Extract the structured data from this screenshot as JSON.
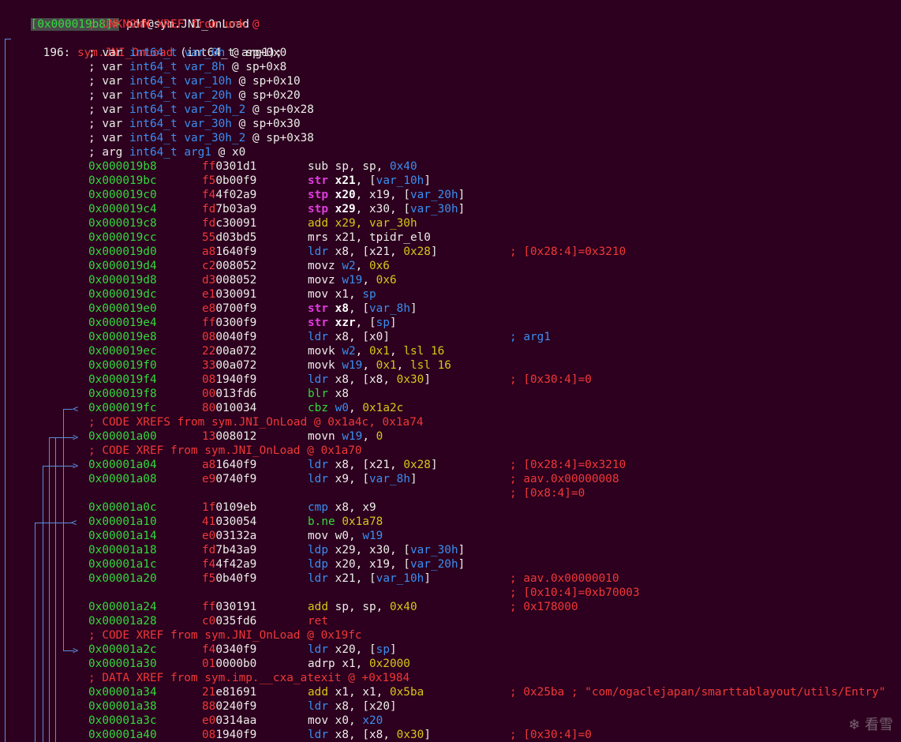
{
  "prompt": {
    "addr": "[0x000019b8]>",
    "cmd": " pdf@sym.JNI_OnLoad"
  },
  "header": {
    "xref": "; UNKNOWN XREF from unk @",
    "func_num": "196:",
    "func_name": "sym.JNI_OnLoad",
    "func_sig": " (int64_t arg1);"
  },
  "vars": [
    {
      "t": "; var ",
      "type": "int64_t",
      "name": "var_0h",
      "loc": " @ sp+0x0"
    },
    {
      "t": "; var ",
      "type": "int64_t",
      "name": "var_8h",
      "loc": " @ sp+0x8"
    },
    {
      "t": "; var ",
      "type": "int64_t",
      "name": "var_10h",
      "loc": " @ sp+0x10"
    },
    {
      "t": "; var ",
      "type": "int64_t",
      "name": "var_20h",
      "loc": " @ sp+0x20"
    },
    {
      "t": "; var ",
      "type": "int64_t",
      "name": "var_20h_2",
      "loc": " @ sp+0x28"
    },
    {
      "t": "; var ",
      "type": "int64_t",
      "name": "var_30h",
      "loc": " @ sp+0x30"
    },
    {
      "t": "; var ",
      "type": "int64_t",
      "name": "var_30h_2",
      "loc": " @ sp+0x38"
    },
    {
      "t": "; arg ",
      "type": "int64_t",
      "name": "arg1",
      "loc": " @ x0"
    }
  ],
  "xrefs": {
    "x1": "; CODE XREFS from sym.JNI_OnLoad @ 0x1a4c, 0x1a74",
    "x2": "; CODE XREF from sym.JNI_OnLoad @ 0x1a70",
    "x3": "; CODE XREF from sym.JNI_OnLoad @ 0x19fc",
    "x4": "; DATA XREF from sym.imp.__cxa_atexit @ +0x1984"
  },
  "insns": [
    {
      "a": "0x000019b8",
      "b1": "ff",
      "b2": "0301d1",
      "m": "sub",
      "mc": "white",
      "ops": [
        [
          "sp, sp, ",
          "white"
        ],
        [
          "0x40",
          "blue"
        ]
      ],
      "c": ""
    },
    {
      "a": "0x000019bc",
      "b1": "f5",
      "b2": "0b00f9",
      "m": "str",
      "mc": "mag",
      "ops": [
        [
          "x21",
          "wb"
        ],
        [
          ", [",
          "white"
        ],
        [
          "var_10h",
          "blue"
        ],
        [
          "]",
          "white"
        ]
      ],
      "c": ""
    },
    {
      "a": "0x000019c0",
      "b1": "f4",
      "b2": "4f02a9",
      "m": "stp",
      "mc": "mag",
      "ops": [
        [
          "x20",
          "wb"
        ],
        [
          ", x19, [",
          "white"
        ],
        [
          "var_20h",
          "blue"
        ],
        [
          "]",
          "white"
        ]
      ],
      "c": ""
    },
    {
      "a": "0x000019c4",
      "b1": "fd",
      "b2": "7b03a9",
      "m": "stp",
      "mc": "mag",
      "ops": [
        [
          "x29",
          "wb"
        ],
        [
          ", x30, [",
          "white"
        ],
        [
          "var_30h",
          "blue"
        ],
        [
          "]",
          "white"
        ]
      ],
      "c": ""
    },
    {
      "a": "0x000019c8",
      "b1": "fd",
      "b2": "c30091",
      "m": "add",
      "mc": "yellow",
      "ops": [
        [
          "x29, var_30h",
          "yellow"
        ]
      ],
      "c": ""
    },
    {
      "a": "0x000019cc",
      "b1": "55",
      "b2": "d03bd5",
      "m": "mrs",
      "mc": "white",
      "ops": [
        [
          "x21, tpidr_el0",
          "white"
        ]
      ],
      "c": ""
    },
    {
      "a": "0x000019d0",
      "b1": "a8",
      "b2": "1640f9",
      "m": "ldr",
      "mc": "blue",
      "ops": [
        [
          "x8, [x21, ",
          "white"
        ],
        [
          "0x28",
          "yellow"
        ],
        [
          "]",
          "white"
        ]
      ],
      "c": "; [0x28:4]=0x3210",
      "cc": "red"
    },
    {
      "a": "0x000019d4",
      "b1": "c2",
      "b2": "008052",
      "m": "movz",
      "mc": "white",
      "ops": [
        [
          "w2",
          "blue"
        ],
        [
          ", ",
          "white"
        ],
        [
          "0x6",
          "yellow"
        ]
      ],
      "c": ""
    },
    {
      "a": "0x000019d8",
      "b1": "d3",
      "b2": "008052",
      "m": "movz",
      "mc": "white",
      "ops": [
        [
          "w19",
          "blue"
        ],
        [
          ", ",
          "white"
        ],
        [
          "0x6",
          "yellow"
        ]
      ],
      "c": ""
    },
    {
      "a": "0x000019dc",
      "b1": "e1",
      "b2": "030091",
      "m": "mov",
      "mc": "white",
      "ops": [
        [
          "x1, ",
          "white"
        ],
        [
          "sp",
          "blue"
        ]
      ],
      "c": ""
    },
    {
      "a": "0x000019e0",
      "b1": "e8",
      "b2": "0700f9",
      "m": "str",
      "mc": "mag",
      "ops": [
        [
          "x8",
          "wb"
        ],
        [
          ", [",
          "white"
        ],
        [
          "var_8h",
          "blue"
        ],
        [
          "]",
          "white"
        ]
      ],
      "c": ""
    },
    {
      "a": "0x000019e4",
      "b1": "ff",
      "b2": "0300f9",
      "m": "str",
      "mc": "mag",
      "ops": [
        [
          "xzr",
          "wb"
        ],
        [
          ", [",
          "white"
        ],
        [
          "sp",
          "blue"
        ],
        [
          "]",
          "white"
        ]
      ],
      "c": ""
    },
    {
      "a": "0x000019e8",
      "b1": "08",
      "b2": "0040f9",
      "m": "ldr",
      "mc": "blue",
      "ops": [
        [
          "x8, [x0]",
          "white"
        ]
      ],
      "c": "; arg1",
      "cc": "blue"
    },
    {
      "a": "0x000019ec",
      "b1": "22",
      "b2": "00a072",
      "m": "movk",
      "mc": "white",
      "ops": [
        [
          "w2",
          "blue"
        ],
        [
          ", ",
          "white"
        ],
        [
          "0x1",
          "yellow"
        ],
        [
          ", ",
          "white"
        ],
        [
          "lsl 16",
          "yellow"
        ]
      ],
      "c": ""
    },
    {
      "a": "0x000019f0",
      "b1": "33",
      "b2": "00a072",
      "m": "movk",
      "mc": "white",
      "ops": [
        [
          "w19",
          "blue"
        ],
        [
          ", ",
          "white"
        ],
        [
          "0x1",
          "yellow"
        ],
        [
          ", ",
          "white"
        ],
        [
          "lsl 16",
          "yellow"
        ]
      ],
      "c": ""
    },
    {
      "a": "0x000019f4",
      "b1": "08",
      "b2": "1940f9",
      "m": "ldr",
      "mc": "blue",
      "ops": [
        [
          "x8, [x8, ",
          "white"
        ],
        [
          "0x30",
          "yellow"
        ],
        [
          "]",
          "white"
        ]
      ],
      "c": "; [0x30:4]=0",
      "cc": "red"
    },
    {
      "a": "0x000019f8",
      "b1": "00",
      "b2": "013fd6",
      "m": "blr",
      "mc": "green",
      "ops": [
        [
          "x8",
          "white"
        ]
      ],
      "c": ""
    },
    {
      "a": "0x000019fc",
      "b1": "80",
      "b2": "010034",
      "m": "cbz",
      "mc": "green",
      "ops": [
        [
          "w0",
          "blue"
        ],
        [
          ", ",
          "white"
        ],
        [
          "0x1a2c",
          "yellow"
        ]
      ],
      "c": ""
    },
    {
      "a": "0x00001a00",
      "b1": "13",
      "b2": "008012",
      "m": "movn",
      "mc": "white",
      "ops": [
        [
          "w19",
          "blue"
        ],
        [
          ", ",
          "white"
        ],
        [
          "0",
          "yellow"
        ]
      ],
      "c": ""
    },
    {
      "a": "0x00001a04",
      "b1": "a8",
      "b2": "1640f9",
      "m": "ldr",
      "mc": "blue",
      "ops": [
        [
          "x8, [x21, ",
          "white"
        ],
        [
          "0x28",
          "yellow"
        ],
        [
          "]",
          "white"
        ]
      ],
      "c": "; [0x28:4]=0x3210",
      "cc": "red"
    },
    {
      "a": "0x00001a08",
      "b1": "e9",
      "b2": "0740f9",
      "m": "ldr",
      "mc": "blue",
      "ops": [
        [
          "x9, [",
          "white"
        ],
        [
          "var_8h",
          "blue"
        ],
        [
          "]",
          "white"
        ]
      ],
      "c": "; aav.0x00000008",
      "cc": "red"
    },
    {
      "a": "0x00001a0c",
      "b1": "1f",
      "b2": "0109eb",
      "m": "cmp",
      "mc": "blue",
      "ops": [
        [
          "x8, x9",
          "white"
        ]
      ],
      "c": ""
    },
    {
      "a": "0x00001a10",
      "b1": "41",
      "b2": "030054",
      "m": "b.ne",
      "mc": "green",
      "ops": [
        [
          "0x1a78",
          "yellow"
        ]
      ],
      "c": ""
    },
    {
      "a": "0x00001a14",
      "b1": "e0",
      "b2": "03132a",
      "m": "mov",
      "mc": "white",
      "ops": [
        [
          "w0, ",
          "white"
        ],
        [
          "w19",
          "blue"
        ]
      ],
      "c": ""
    },
    {
      "a": "0x00001a18",
      "b1": "fd",
      "b2": "7b43a9",
      "m": "ldp",
      "mc": "blue",
      "ops": [
        [
          "x29, x30, [",
          "white"
        ],
        [
          "var_30h",
          "blue"
        ],
        [
          "]",
          "white"
        ]
      ],
      "c": ""
    },
    {
      "a": "0x00001a1c",
      "b1": "f4",
      "b2": "4f42a9",
      "m": "ldp",
      "mc": "blue",
      "ops": [
        [
          "x20, x19, [",
          "white"
        ],
        [
          "var_20h",
          "blue"
        ],
        [
          "]",
          "white"
        ]
      ],
      "c": ""
    },
    {
      "a": "0x00001a20",
      "b1": "f5",
      "b2": "0b40f9",
      "m": "ldr",
      "mc": "blue",
      "ops": [
        [
          "x21, [",
          "white"
        ],
        [
          "var_10h",
          "blue"
        ],
        [
          "]",
          "white"
        ]
      ],
      "c": "; aav.0x00000010",
      "cc": "red"
    },
    {
      "a": "0x00001a24",
      "b1": "ff",
      "b2": "030191",
      "m": "add",
      "mc": "yellow",
      "ops": [
        [
          "sp, sp, ",
          "white"
        ],
        [
          "0x40",
          "yellow"
        ]
      ],
      "c": "; 0x178000",
      "cc": "red"
    },
    {
      "a": "0x00001a28",
      "b1": "c0",
      "b2": "035fd6",
      "m": "ret",
      "mc": "red",
      "ops": [],
      "c": ""
    },
    {
      "a": "0x00001a2c",
      "b1": "f4",
      "b2": "0340f9",
      "m": "ldr",
      "mc": "blue",
      "ops": [
        [
          "x20, [",
          "white"
        ],
        [
          "sp",
          "blue"
        ],
        [
          "]",
          "white"
        ]
      ],
      "c": ""
    },
    {
      "a": "0x00001a30",
      "b1": "01",
      "b2": "0000b0",
      "m": "adrp",
      "mc": "white",
      "ops": [
        [
          "x1, ",
          "white"
        ],
        [
          "0x2000",
          "yellow"
        ]
      ],
      "c": ""
    },
    {
      "a": "0x00001a34",
      "b1": "21",
      "b2": "e81691",
      "m": "add",
      "mc": "yellow",
      "ops": [
        [
          "x1, x1, ",
          "white"
        ],
        [
          "0x5ba",
          "yellow"
        ]
      ],
      "c": "; 0x25ba ; \"com/ogaclejapan/smarttablayout/utils/Entry\"",
      "cc": "red"
    },
    {
      "a": "0x00001a38",
      "b1": "88",
      "b2": "0240f9",
      "m": "ldr",
      "mc": "blue",
      "ops": [
        [
          "x8, [x20]",
          "white"
        ]
      ],
      "c": ""
    },
    {
      "a": "0x00001a3c",
      "b1": "e0",
      "b2": "0314aa",
      "m": "mov",
      "mc": "white",
      "ops": [
        [
          "x0, ",
          "white"
        ],
        [
          "x20",
          "blue"
        ]
      ],
      "c": ""
    },
    {
      "a": "0x00001a40",
      "b1": "08",
      "b2": "1940f9",
      "m": "ldr",
      "mc": "blue",
      "ops": [
        [
          "x8, [x8, ",
          "white"
        ],
        [
          "0x30",
          "yellow"
        ],
        [
          "]",
          "white"
        ]
      ],
      "c": "; [0x30:4]=0",
      "cc": "red"
    }
  ],
  "extra_comments": {
    "after_1a08": "; [0x8:4]=0",
    "after_1a20": "; [0x10:4]=0xb70003"
  },
  "watermark": "看雪",
  "colors": {
    "bg": "#2c001e",
    "addr": "#33da3d",
    "comment": "#ef3838",
    "type": "#3b8ef0"
  }
}
